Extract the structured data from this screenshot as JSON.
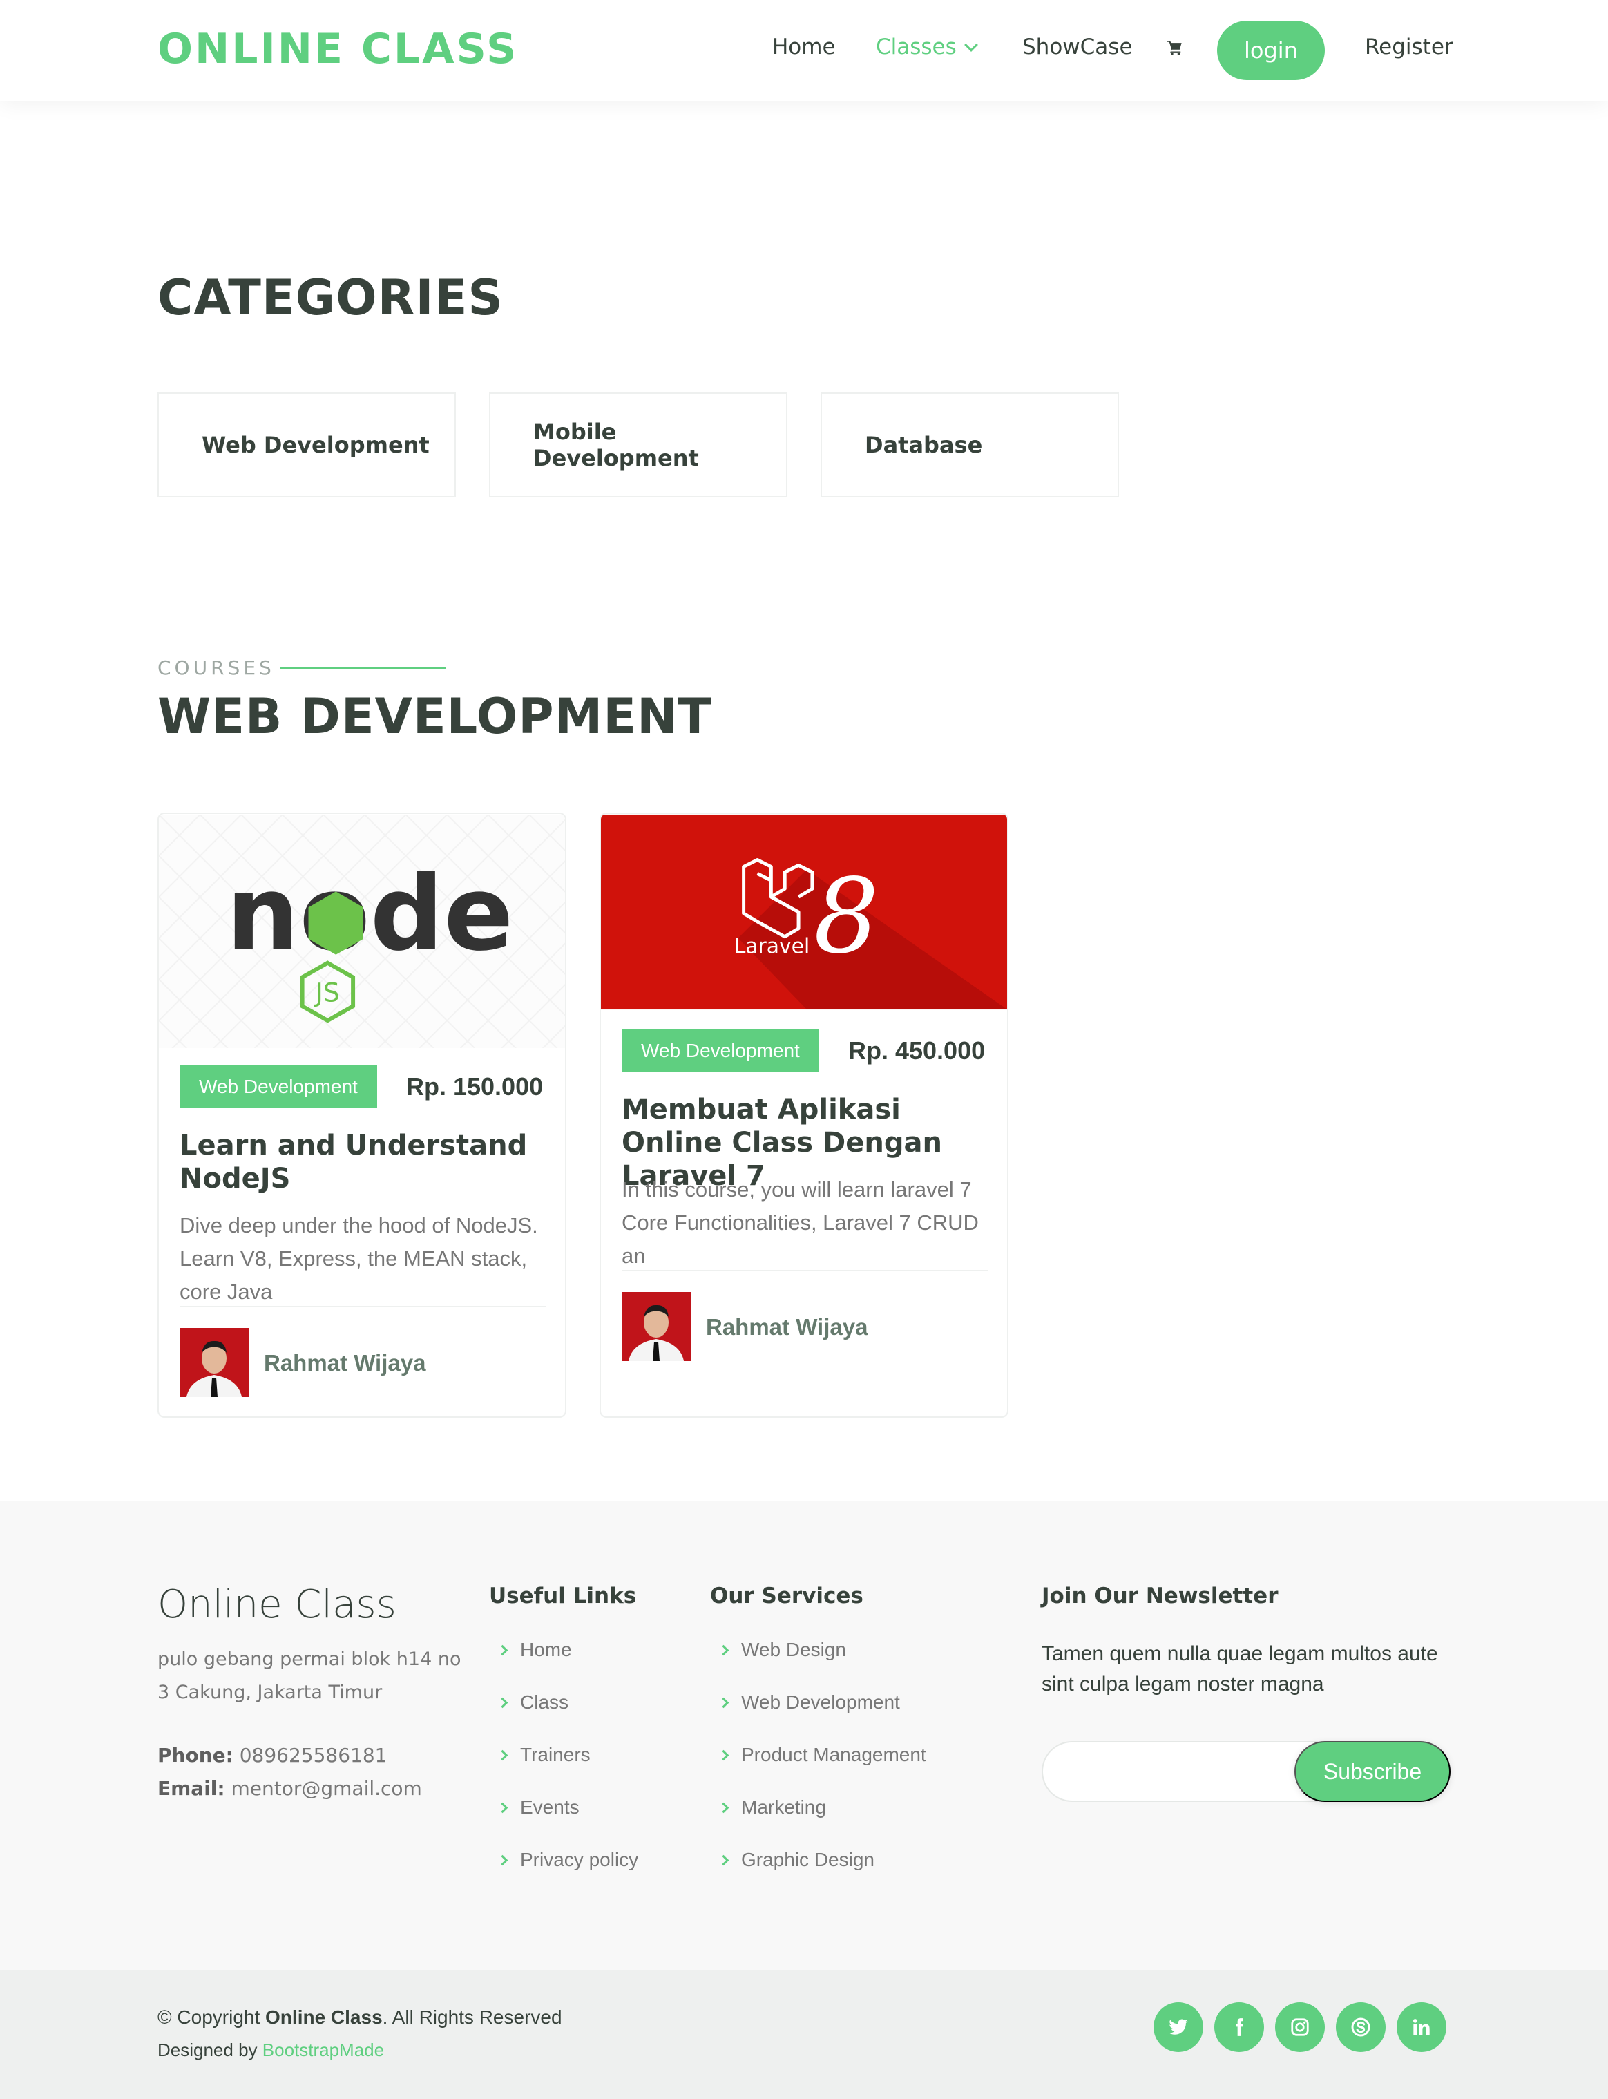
{
  "header": {
    "logo": "ONLINE CLASS",
    "nav": {
      "home": "Home",
      "classes": "Classes",
      "showcase": "ShowCase",
      "login": "login",
      "register": "Register"
    }
  },
  "categories": {
    "title": "CATEGORIES",
    "items": [
      "Web Development",
      "Mobile Development",
      "Database"
    ]
  },
  "courses": {
    "label": "COURSES",
    "title": "WEB DEVELOPMENT",
    "cards": [
      {
        "badge": "Web Development",
        "price": "Rp. 150.000",
        "title": "Learn and Understand NodeJS",
        "desc": "Dive deep under the hood of NodeJS. Learn V8, Express, the MEAN stack, core Java",
        "trainer": "Rahmat Wijaya",
        "logo_word": "node",
        "logo_badge": "JS"
      },
      {
        "badge": "Web Development",
        "price": "Rp. 450.000",
        "title": "Membuat Aplikasi Online Class Dengan Laravel 7",
        "desc": "In this course, you will learn laravel 7 Core Functionalities, Laravel 7 CRUD an",
        "trainer": "Rahmat Wijaya",
        "logo_word": "Laravel",
        "logo_version": "8"
      }
    ]
  },
  "footer": {
    "brand": "Online Class",
    "address": "pulo gebang permai blok h14 no 3 Cakung, Jakarta Timur",
    "phone_label": "Phone:",
    "phone": "089625586181",
    "email_label": "Email:",
    "email": "mentor@gmail.com",
    "useful_links": {
      "title": "Useful Links",
      "items": [
        "Home",
        "Class",
        "Trainers",
        "Events",
        "Privacy policy"
      ]
    },
    "services": {
      "title": "Our Services",
      "items": [
        "Web Design",
        "Web Development",
        "Product Management",
        "Marketing",
        "Graphic Design"
      ]
    },
    "newsletter": {
      "title": "Join Our Newsletter",
      "text": "Tamen quem nulla quae legam multos aute sint culpa legam noster magna",
      "button": "Subscribe",
      "placeholder": ""
    },
    "copyright": {
      "prefix": "© Copyright ",
      "brand": "Online Class",
      "suffix": ". All Rights Reserved",
      "designed_prefix": "Designed by ",
      "designed_by": "BootstrapMade"
    },
    "social": [
      "twitter-icon",
      "facebook-icon",
      "instagram-icon",
      "skype-icon",
      "linkedin-icon"
    ]
  },
  "colors": {
    "accent": "#5fcf80",
    "text": "#37423b",
    "laravel_red": "#d0120b"
  }
}
